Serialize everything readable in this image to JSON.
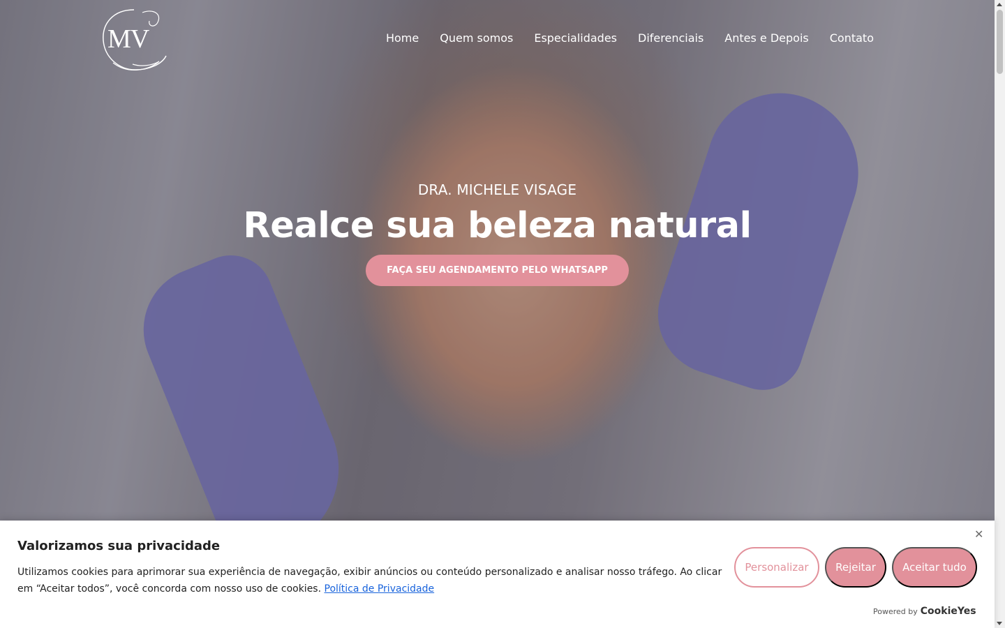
{
  "brand": {
    "logo_text": "MV"
  },
  "nav": {
    "items": [
      {
        "label": "Home"
      },
      {
        "label": "Quem somos"
      },
      {
        "label": "Especialidades"
      },
      {
        "label": "Diferenciais"
      },
      {
        "label": "Antes e Depois"
      },
      {
        "label": "Contato"
      }
    ]
  },
  "hero": {
    "eyebrow": "DRA. MICHELE VISAGE",
    "headline": "Realce sua beleza natural",
    "cta_label": "FAÇA SEU AGENDAMENTO PELO WHATSAPP"
  },
  "cookie": {
    "title": "Valorizamos sua privacidade",
    "text": "Utilizamos cookies para aprimorar sua experiência de navegação, exibir anúncios ou conteúdo personalizado e analisar nosso tráfego. Ao clicar em “Aceitar todos”, você concorda com nosso uso de cookies. ",
    "policy_link": "Política de Privacidade",
    "buttons": {
      "customize": "Personalizar",
      "reject": "Rejeitar",
      "accept": "Aceitar tudo"
    },
    "close_icon": "close-icon",
    "powered_by": "Powered by",
    "provider": "CookieYes"
  },
  "colors": {
    "accent": "#e2919b",
    "link": "#1863dc"
  }
}
